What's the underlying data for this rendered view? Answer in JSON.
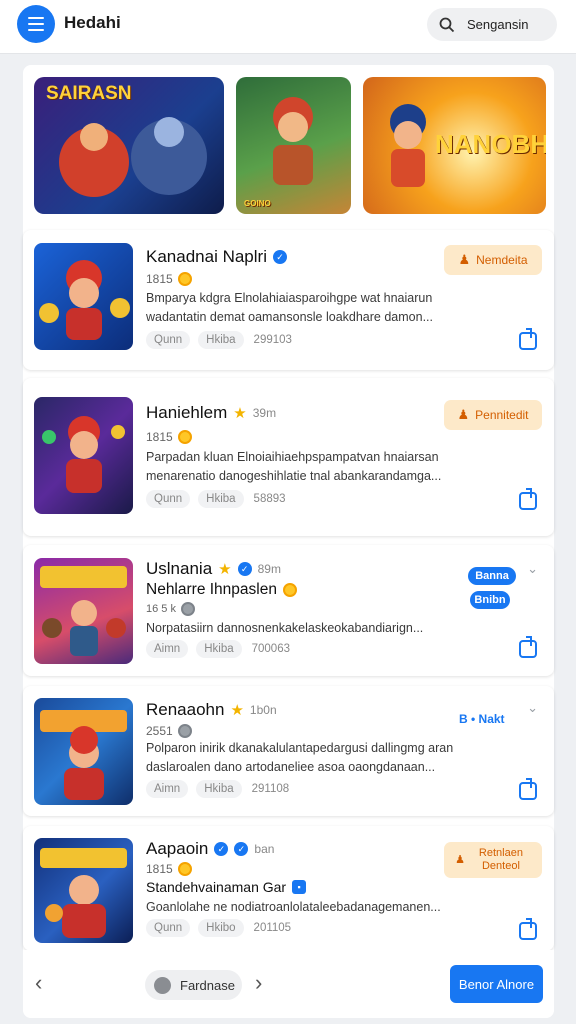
{
  "app": {
    "title": "Hedahi",
    "search_label": "Sengansin"
  },
  "banners": [
    {
      "label": "SAIRASN"
    },
    {
      "label": "GOINO"
    },
    {
      "label": "NANOBH"
    }
  ],
  "cards": [
    {
      "title": "Kanadnai Naplri",
      "sub": "1815",
      "desc1": "Bmparya kdgra Elnolahiaiasparoihgpe wat hnaiarun",
      "desc2": "wadantatin demat oamansonsle loakdhare damon...",
      "tags": [
        "Qunn",
        "Hkiba",
        "299103"
      ],
      "action": "Nemdeita"
    },
    {
      "title": "Haniehlem",
      "meta": "39m",
      "sub": "1815",
      "desc1": "Parpadan kluan Elnoiaihiaehpspampatvan hnaiarsan",
      "desc2": "menarenatio danogeshihlatie tnal abankarandamga...",
      "tags": [
        "Qunn",
        "Hkiba",
        "58893"
      ],
      "action": "Pennitedit"
    },
    {
      "title": "Uslnania",
      "meta": "89m",
      "subtitle": "Nehlarre Ihnpaslen",
      "sub": "16 5 k",
      "desc1": "Norpatasiirn dannosnenkakelaskeokabandiarign...",
      "tags": [
        "Aimn",
        "Hkiba",
        "700063"
      ],
      "pills": [
        "Banna",
        "Bnibn"
      ]
    },
    {
      "title": "Renaaohn",
      "meta": "1b0n",
      "sub": "2551",
      "desc1": "Polparon inirik dkanakalulantapedargusi dallingmg aran",
      "desc2": "daslaroalen dano artodaneliee asoa oaongdanaan...",
      "tags": [
        "Aimn",
        "Hkiba",
        "291108"
      ],
      "action": "B • Nakt"
    },
    {
      "title": "Aapaoin",
      "meta": "ban",
      "sub": "1815",
      "subtitle": "Standehvainaman Gar",
      "desc1": "Goanlolahe ne nodiatroanlolataleebadanagemanen...",
      "tags": [
        "Qunn",
        "Hkibo",
        "201105"
      ],
      "action": "Retnlaen Denteol"
    }
  ],
  "footer": {
    "page_label": "Fardnase",
    "cta": "Benor Alnore"
  },
  "colors": {
    "accent": "#1877f2",
    "action_bg": "#fde9c9",
    "action_fg": "#d35e00"
  }
}
